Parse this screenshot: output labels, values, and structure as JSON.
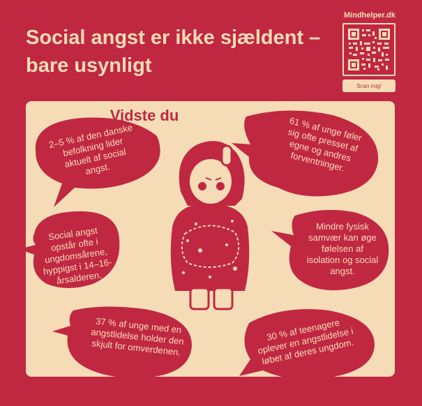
{
  "header": {
    "title": "Social angst er ikke sjældent – bare usynligt"
  },
  "brand": {
    "site": "Mindhelper.dk",
    "qr_icon": "qr-code-icon",
    "scan_label": "Scan mig!"
  },
  "panel": {
    "title": "Vidste du",
    "facts": [
      "2–5 % af den danske befolkning lider aktuelt af social angst.",
      "61 % af unge føler sig ofte presset af egne og andres forventninger.",
      "Social angst opstår ofte i ungdomsårene, hyppigst i 14–16-årsalderen.",
      "Mindre fysisk samvær kan øge følelsen af isolation og social angst.",
      "37 % af unge med en angstlidelse holder den skjult for omverdenen.",
      "30 % af teenagere oplever en angstlidelse i løbet af deres ungdom."
    ],
    "illustration": "sad-girl-hugging-knees-illustration"
  },
  "colors": {
    "background": "#c02842",
    "cream": "#f6dcb6"
  }
}
